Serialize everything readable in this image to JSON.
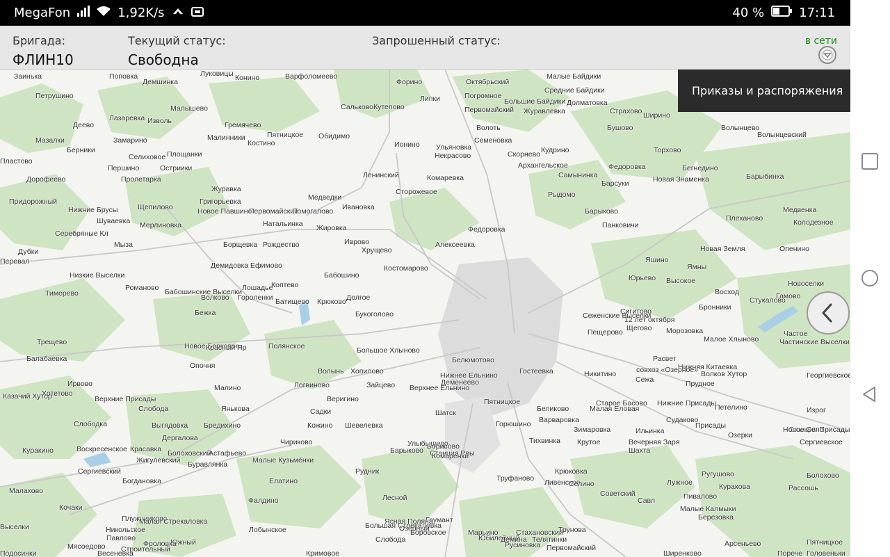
{
  "statusbar": {
    "carrier": "MegaFon",
    "speed": "1,92K/s",
    "battery": "40 %",
    "time": "17:11",
    "icons": [
      "signal-icon",
      "wifi-icon",
      "data-saver-icon",
      "vpn-icon",
      "battery-icon"
    ]
  },
  "header": {
    "brigade_label": "Бригада:",
    "brigade_value": "ФЛИН10",
    "current_status_label": "Текущий статус:",
    "current_status_value": "Свободна",
    "requested_status_label": "Запрошенный статус:",
    "requested_status_value": "",
    "connection": "в сети"
  },
  "menu_popup": {
    "item": "Приказы и распоряжения"
  },
  "colors": {
    "header_bg": "#e6e6e6",
    "online_text": "#1e8a1e",
    "popup_bg": "#2b2b2b",
    "map_bg": "#f4f5f1",
    "forest": "#cfe4c2",
    "water": "#a9cfe6"
  },
  "map": {
    "places": [
      "Заинька",
      "Поповка",
      "Демшинка",
      "Луковицы",
      "Конино",
      "Варфоломеево",
      "Форино",
      "Октябрьский",
      "Малые Байдики",
      "Петрушино",
      "Малышево",
      "Сальково",
      "Кутепово",
      "Липки",
      "Погромное",
      "Средние Байдики",
      "Большие Байдики",
      "Долматовка",
      "Лазаревка",
      "Изволь",
      "Гремячево",
      "Первомайский",
      "Журавлевка",
      "Страхово",
      "Ширино",
      "Деево",
      "Пятницкое",
      "Обидимо",
      "Волоть",
      "Бушово",
      "Волынцево",
      "Малинники",
      "Мазалки",
      "Замарино",
      "Костино",
      "Ионино",
      "Ульяновка",
      "Семеновка",
      "Кудрино",
      "Волынцевский",
      "Берники",
      "Селиховое",
      "Площанки",
      "Некрасово",
      "Скорнево",
      "Торхово",
      "Пластово",
      "Першино",
      "Остриики",
      "Ленинский",
      "Архангельское",
      "Федоровка",
      "Бегнедино",
      "Дорофеево",
      "Пролетарка",
      "Комаревка",
      "Самынинка",
      "Новая Знаменка",
      "Барыбинка",
      "Журавка",
      "Медведки",
      "Сторожевое",
      "Барсуки",
      "Придорожный",
      "Григорьевка",
      "Рыдомо",
      "Ивановка",
      "Щепилово",
      "Нижние Брусы",
      "Новое Павшино",
      "Первомайский",
      "Помогалово",
      "Барыково",
      "Медвенка",
      "Шуваевка",
      "Мерлиновка",
      "Натальинка",
      "Жировка",
      "Федоровка",
      "Плеханово",
      "Колодезное",
      "Серебряные Кл",
      "Панковичи",
      "Мыза",
      "Борщевка",
      "Рождество",
      "Иврово",
      "Алексеевка",
      "Хрущево",
      "Новая Земля",
      "Опенино",
      "Дубки",
      "Яшино",
      "Демидовка",
      "Ефимово",
      "Костомарово",
      "Ямны",
      "Перевал",
      "Низкие Выселки",
      "Бабошино",
      "Юрьево",
      "Высокое",
      "Новоселки",
      "Романово",
      "Лошадье",
      "Коптево",
      "Восход",
      "Тимерево",
      "Бабошинские Выселки",
      "Гороленки",
      "Волково",
      "Батищево",
      "Крюково",
      "Долгое",
      "Стукалово",
      "Гамово",
      "Бронники",
      "Сигитово",
      "Бежка",
      "Букоголово",
      "12 лет октября",
      "Сеженские Выселки",
      "Щегово",
      "Пещерово",
      "Морозовка",
      "Частое",
      "Трещево",
      "Новое Берковое",
      "Полянское",
      "Малое Хлыново",
      "Частинские Выселки",
      "Красный Яр",
      "Большое Хлыново",
      "Расвет",
      "Балабаевка",
      "Опочня",
      "Белюмотово",
      "Нижняя Китаевка",
      "совхоз «Озерное»",
      "Волынь",
      "Хопилово",
      "Гостеевка",
      "Волков Хутор",
      "Сежа",
      "Нижнее Ельнино",
      "Никитино",
      "Георгиевское",
      "Ирвово",
      "Малино",
      "Логвиново",
      "Зайцево",
      "Деменеево",
      "Верхнее Ельнино",
      "Прудное",
      "Казачий Хутор",
      "Хотетово",
      "Веригино",
      "Пятницкое",
      "Старое Басово",
      "Нижние Присады",
      "Верхние Присады",
      "Слобода",
      "Янькова",
      "Садки",
      "Беликово",
      "Малая Еловая",
      "Петелино",
      "Шатск",
      "Судаково",
      "Присады",
      "Станция Присады",
      "Изрог",
      "Слободка",
      "Выгядовка",
      "Бредихино",
      "Кожино",
      "Шевелевка",
      "Горюшино",
      "Варваровка",
      "Зимаровка",
      "Ильинка",
      "Озерки",
      "Новое Село",
      "Куракино",
      "Воскресенское",
      "Дергалова",
      "Красавка",
      "Улыбышево",
      "Рвы",
      "Тихвинка",
      "Крутое",
      "Вечерняя Заря",
      "Сергиевское",
      "Болоховский",
      "Астафьево",
      "Чириково",
      "Борисово",
      "Станция Рвы",
      "Шахта",
      "Сергиевский",
      "Жигулевский",
      "Буравлянка",
      "Малые Кузьмёнки",
      "Комаренки",
      "Рудник",
      "Барыково",
      "Ругушово",
      "Болохово",
      "Рассошь",
      "Богдановка",
      "Елатино",
      "Труфаново",
      "Ливенское",
      "Крюковка",
      "Советский",
      "Савл",
      "Лужное",
      "Куракова",
      "Малахово",
      "Фалдино",
      "Лобынское",
      "Березовка",
      "Южный",
      "Марьино",
      "Селино",
      "Лесной",
      "Грумант",
      "Большая Стрекаловка",
      "Озерный",
      "Стахановский",
      "Трунова",
      "Ясная Поляна",
      "Кочаки",
      "Плужнииково",
      "Малая Стрекаловка",
      "Боровское",
      "Слобода",
      "Юбилейный",
      "Телятинки",
      "Демина",
      "Малые Калмыки",
      "Пятницкое",
      "Никольское",
      "Мясоедово",
      "Фроловка",
      "Строительный",
      "Павлово",
      "Русиновка",
      "Первомайский",
      "Пивалово",
      "Арсеньево",
      "Головеньки",
      "Подосинки",
      "Кримовое",
      "Ширенково",
      "Весеневка",
      "Порече",
      "Выселки"
    ]
  }
}
